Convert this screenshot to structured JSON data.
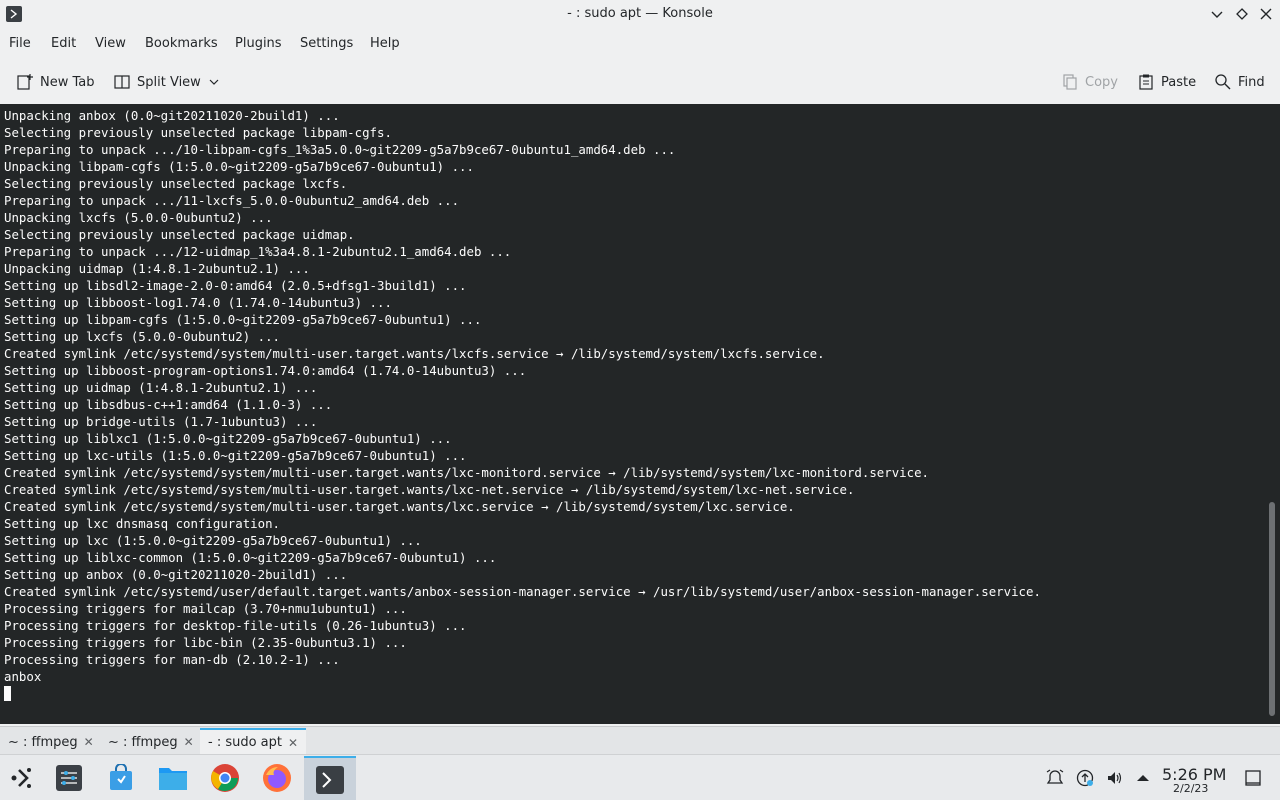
{
  "window": {
    "title": "- : sudo apt — Konsole"
  },
  "menu": [
    "File",
    "Edit",
    "View",
    "Bookmarks",
    "Plugins",
    "Settings",
    "Help"
  ],
  "toolbar": {
    "new_tab": "New Tab",
    "split_view": "Split View",
    "copy": "Copy",
    "paste": "Paste",
    "find": "Find"
  },
  "terminal": {
    "lines": [
      "Unpacking anbox (0.0~git20211020-2build1) ...",
      "Selecting previously unselected package libpam-cgfs.",
      "Preparing to unpack .../10-libpam-cgfs_1%3a5.0.0~git2209-g5a7b9ce67-0ubuntu1_amd64.deb ...",
      "Unpacking libpam-cgfs (1:5.0.0~git2209-g5a7b9ce67-0ubuntu1) ...",
      "Selecting previously unselected package lxcfs.",
      "Preparing to unpack .../11-lxcfs_5.0.0-0ubuntu2_amd64.deb ...",
      "Unpacking lxcfs (5.0.0-0ubuntu2) ...",
      "Selecting previously unselected package uidmap.",
      "Preparing to unpack .../12-uidmap_1%3a4.8.1-2ubuntu2.1_amd64.deb ...",
      "Unpacking uidmap (1:4.8.1-2ubuntu2.1) ...",
      "Setting up libsdl2-image-2.0-0:amd64 (2.0.5+dfsg1-3build1) ...",
      "Setting up libboost-log1.74.0 (1.74.0-14ubuntu3) ...",
      "Setting up libpam-cgfs (1:5.0.0~git2209-g5a7b9ce67-0ubuntu1) ...",
      "Setting up lxcfs (5.0.0-0ubuntu2) ...",
      "Created symlink /etc/systemd/system/multi-user.target.wants/lxcfs.service → /lib/systemd/system/lxcfs.service.",
      "Setting up libboost-program-options1.74.0:amd64 (1.74.0-14ubuntu3) ...",
      "Setting up uidmap (1:4.8.1-2ubuntu2.1) ...",
      "Setting up libsdbus-c++1:amd64 (1.1.0-3) ...",
      "Setting up bridge-utils (1.7-1ubuntu3) ...",
      "Setting up liblxc1 (1:5.0.0~git2209-g5a7b9ce67-0ubuntu1) ...",
      "Setting up lxc-utils (1:5.0.0~git2209-g5a7b9ce67-0ubuntu1) ...",
      "Created symlink /etc/systemd/system/multi-user.target.wants/lxc-monitord.service → /lib/systemd/system/lxc-monitord.service.",
      "Created symlink /etc/systemd/system/multi-user.target.wants/lxc-net.service → /lib/systemd/system/lxc-net.service.",
      "Created symlink /etc/systemd/system/multi-user.target.wants/lxc.service → /lib/systemd/system/lxc.service.",
      "Setting up lxc dnsmasq configuration.",
      "Setting up lxc (1:5.0.0~git2209-g5a7b9ce67-0ubuntu1) ...",
      "Setting up liblxc-common (1:5.0.0~git2209-g5a7b9ce67-0ubuntu1) ...",
      "Setting up anbox (0.0~git20211020-2build1) ...",
      "Created symlink /etc/systemd/user/default.target.wants/anbox-session-manager.service → /usr/lib/systemd/user/anbox-session-manager.service.",
      "Processing triggers for mailcap (3.70+nmu1ubuntu1) ...",
      "Processing triggers for desktop-file-utils (0.26-1ubuntu3) ...",
      "Processing triggers for libc-bin (2.35-0ubuntu3.1) ...",
      "Processing triggers for man-db (2.10.2-1) ...",
      "anbox"
    ]
  },
  "tabs": [
    {
      "label": "~ : ffmpeg",
      "active": false
    },
    {
      "label": "~ : ffmpeg",
      "active": false
    },
    {
      "label": "- : sudo apt",
      "active": true
    }
  ],
  "taskbar": {
    "apps": [
      "application-launcher-icon",
      "system-settings-icon",
      "discover-store-icon",
      "file-manager-icon",
      "chrome-icon",
      "firefox-icon",
      "konsole-icon"
    ],
    "clock_time": "5:26 PM",
    "clock_date": "2/2/23"
  },
  "colors": {
    "accent": "#3daee9",
    "terminal_bg": "#232627",
    "terminal_fg": "#fcfcfc"
  }
}
